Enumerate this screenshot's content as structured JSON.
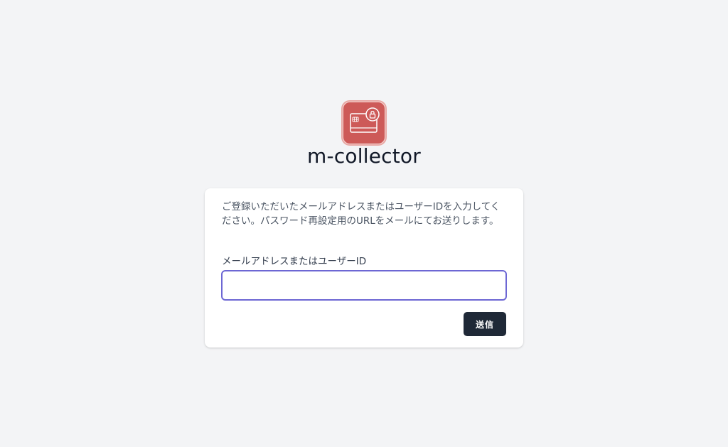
{
  "app": {
    "title": "m-collector",
    "logo_icon": "credit-card-lock-icon",
    "brand_color": "#cd5a58"
  },
  "form": {
    "description": "ご登録いただいたメールアドレスまたはユーザーIDを入力してください。パスワード再設定用のURLをメールにてお送りします。",
    "field_label": "メールアドレスまたはユーザーID",
    "field_value": "",
    "field_placeholder": "",
    "submit_label": "送信",
    "submit_color": "#1f2937",
    "focus_color": "#6d67d4"
  }
}
